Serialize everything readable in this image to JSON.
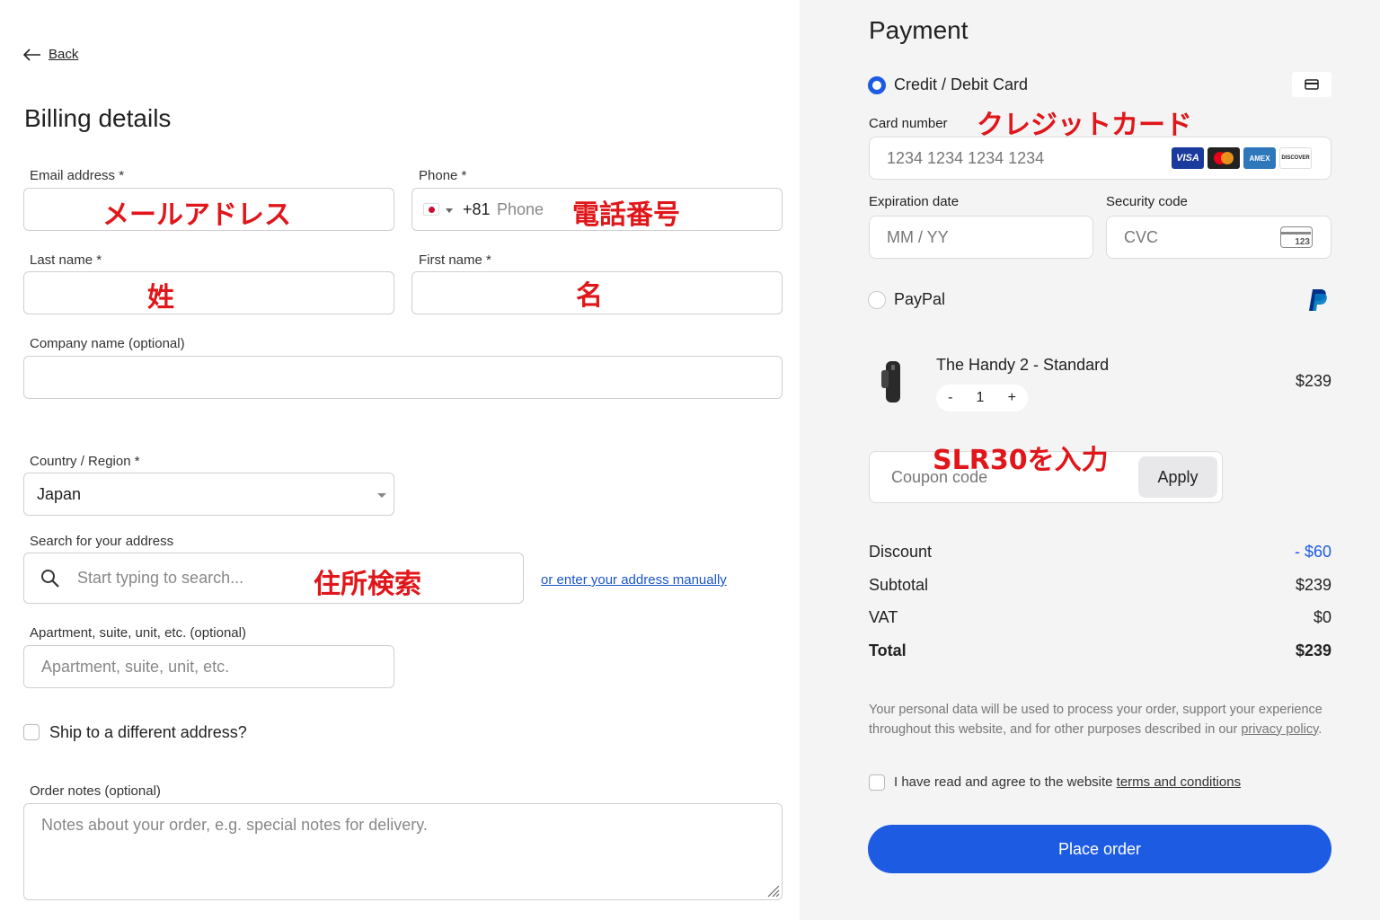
{
  "nav": {
    "back_label": "Back"
  },
  "billing": {
    "title": "Billing details",
    "email_label": "Email address *",
    "email_annotation": "メールアドレス",
    "phone_label": "Phone *",
    "phone_code": "+81",
    "phone_placeholder": "Phone",
    "phone_annotation": "電話番号",
    "last_name_label": "Last name *",
    "last_name_annotation": "姓",
    "first_name_label": "First name *",
    "first_name_annotation": "名",
    "company_label": "Company name (optional)",
    "country_label": "Country / Region *",
    "country_value": "Japan",
    "address_search_label": "Search for your address",
    "address_search_placeholder": "Start typing to search...",
    "address_search_annotation": "住所検索",
    "manual_address_link": "or enter your address manually",
    "apartment_label": "Apartment, suite, unit, etc. (optional)",
    "apartment_placeholder": "Apartment, suite, unit, etc.",
    "ship_different_label": "Ship to a different address?",
    "order_notes_label": "Order notes (optional)",
    "order_notes_placeholder": "Notes about your order, e.g. special notes for delivery."
  },
  "payment": {
    "title": "Payment",
    "credit_label": "Credit / Debit Card",
    "card_number_label": "Card number",
    "card_number_annotation": "クレジットカード",
    "card_number_placeholder": "1234 1234 1234 1234",
    "brands": [
      "VISA",
      "MC",
      "AMEX",
      "DISCOVER"
    ],
    "expiration_label": "Expiration date",
    "expiration_placeholder": "MM / YY",
    "security_label": "Security code",
    "security_placeholder": "CVC",
    "cvc_icon_text": "123",
    "paypal_label": "PayPal"
  },
  "order": {
    "product_name": "The Handy 2 - Standard",
    "qty_minus": "-",
    "qty_value": "1",
    "qty_plus": "+",
    "product_price": "$239",
    "coupon_annotation": "SLR30を入力",
    "coupon_placeholder": "Coupon code",
    "apply_label": "Apply",
    "discount_label": "Discount",
    "discount_value": "- $60",
    "subtotal_label": "Subtotal",
    "subtotal_value": "$239",
    "vat_label": "VAT",
    "vat_value": "$0",
    "total_label": "Total",
    "total_value": "$239"
  },
  "legal": {
    "privacy_text": "Your personal data will be used to process your order, support your experience throughout this website, and for other purposes described in our ",
    "privacy_link": "privacy policy",
    "privacy_end": ".",
    "agree_text": "I have read and agree to the website ",
    "terms_link": "terms and conditions"
  },
  "actions": {
    "place_order_label": "Place order"
  },
  "colors": {
    "accent": "#1d5be3",
    "annotation": "#e0161a",
    "panel": "#f4f4f5"
  }
}
